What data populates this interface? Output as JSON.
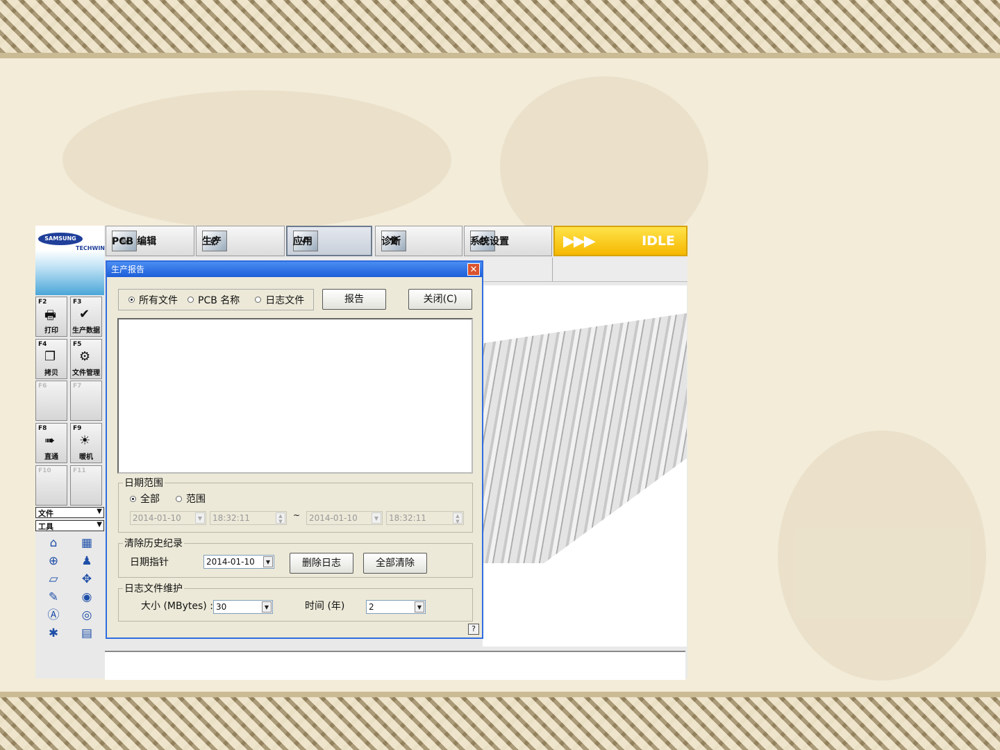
{
  "topbar": {
    "pcb_edit": "PCB 编辑",
    "production": "生产",
    "application": "应用",
    "diagnosis": "诊断",
    "system_settings": "系统设置",
    "status": "IDLE",
    "status_arrows": "▶▶▶"
  },
  "logo": {
    "brand": "SAMSUNG",
    "sub": "TECHWIN"
  },
  "fkeys": [
    {
      "key": "F2",
      "label": "打印",
      "icon": "printer-icon"
    },
    {
      "key": "F3",
      "label": "生产数据",
      "icon": "production-data-icon"
    },
    {
      "key": "F4",
      "label": "拷贝",
      "icon": "copy-icon"
    },
    {
      "key": "F5",
      "label": "文件管理",
      "icon": "file-manage-icon"
    },
    {
      "key": "F6",
      "label": "",
      "icon": ""
    },
    {
      "key": "F7",
      "label": "",
      "icon": ""
    },
    {
      "key": "F8",
      "label": "直通",
      "icon": "pass-through-icon"
    },
    {
      "key": "F9",
      "label": "暖机",
      "icon": "warmup-icon"
    },
    {
      "key": "F10",
      "label": "",
      "icon": ""
    },
    {
      "key": "F11",
      "label": "",
      "icon": ""
    }
  ],
  "menus": {
    "file": "文件",
    "tools": "工具"
  },
  "dialog": {
    "title": "生产报告",
    "radio_all_files": "所有文件",
    "radio_pcb_name": "PCB 名称",
    "radio_log_file": "日志文件",
    "report_button": "报告",
    "close_button": "关闭(C)",
    "date_range": {
      "legend": "日期范围",
      "radio_all": "全部",
      "radio_range": "范围",
      "start_date": "2014-01-10",
      "start_time": "18:32:11",
      "separator": "~",
      "end_date": "2014-01-10",
      "end_time": "18:32:11"
    },
    "clear_history": {
      "legend": "清除历史纪录",
      "date_pointer_label": "日期指针",
      "date_pointer_value": "2014-01-10",
      "delete_log_button": "删除日志",
      "clear_all_button": "全部清除"
    },
    "log_maintenance": {
      "legend": "日志文件维护",
      "size_label": "大小 (MBytes) :",
      "size_value": "30",
      "time_label": "时间 (年)",
      "time_value": "2"
    },
    "help": "?"
  },
  "colors": {
    "titlebar": "#1d5ed8",
    "idle": "#f5b800",
    "dialog_bg": "#ece9d8"
  }
}
